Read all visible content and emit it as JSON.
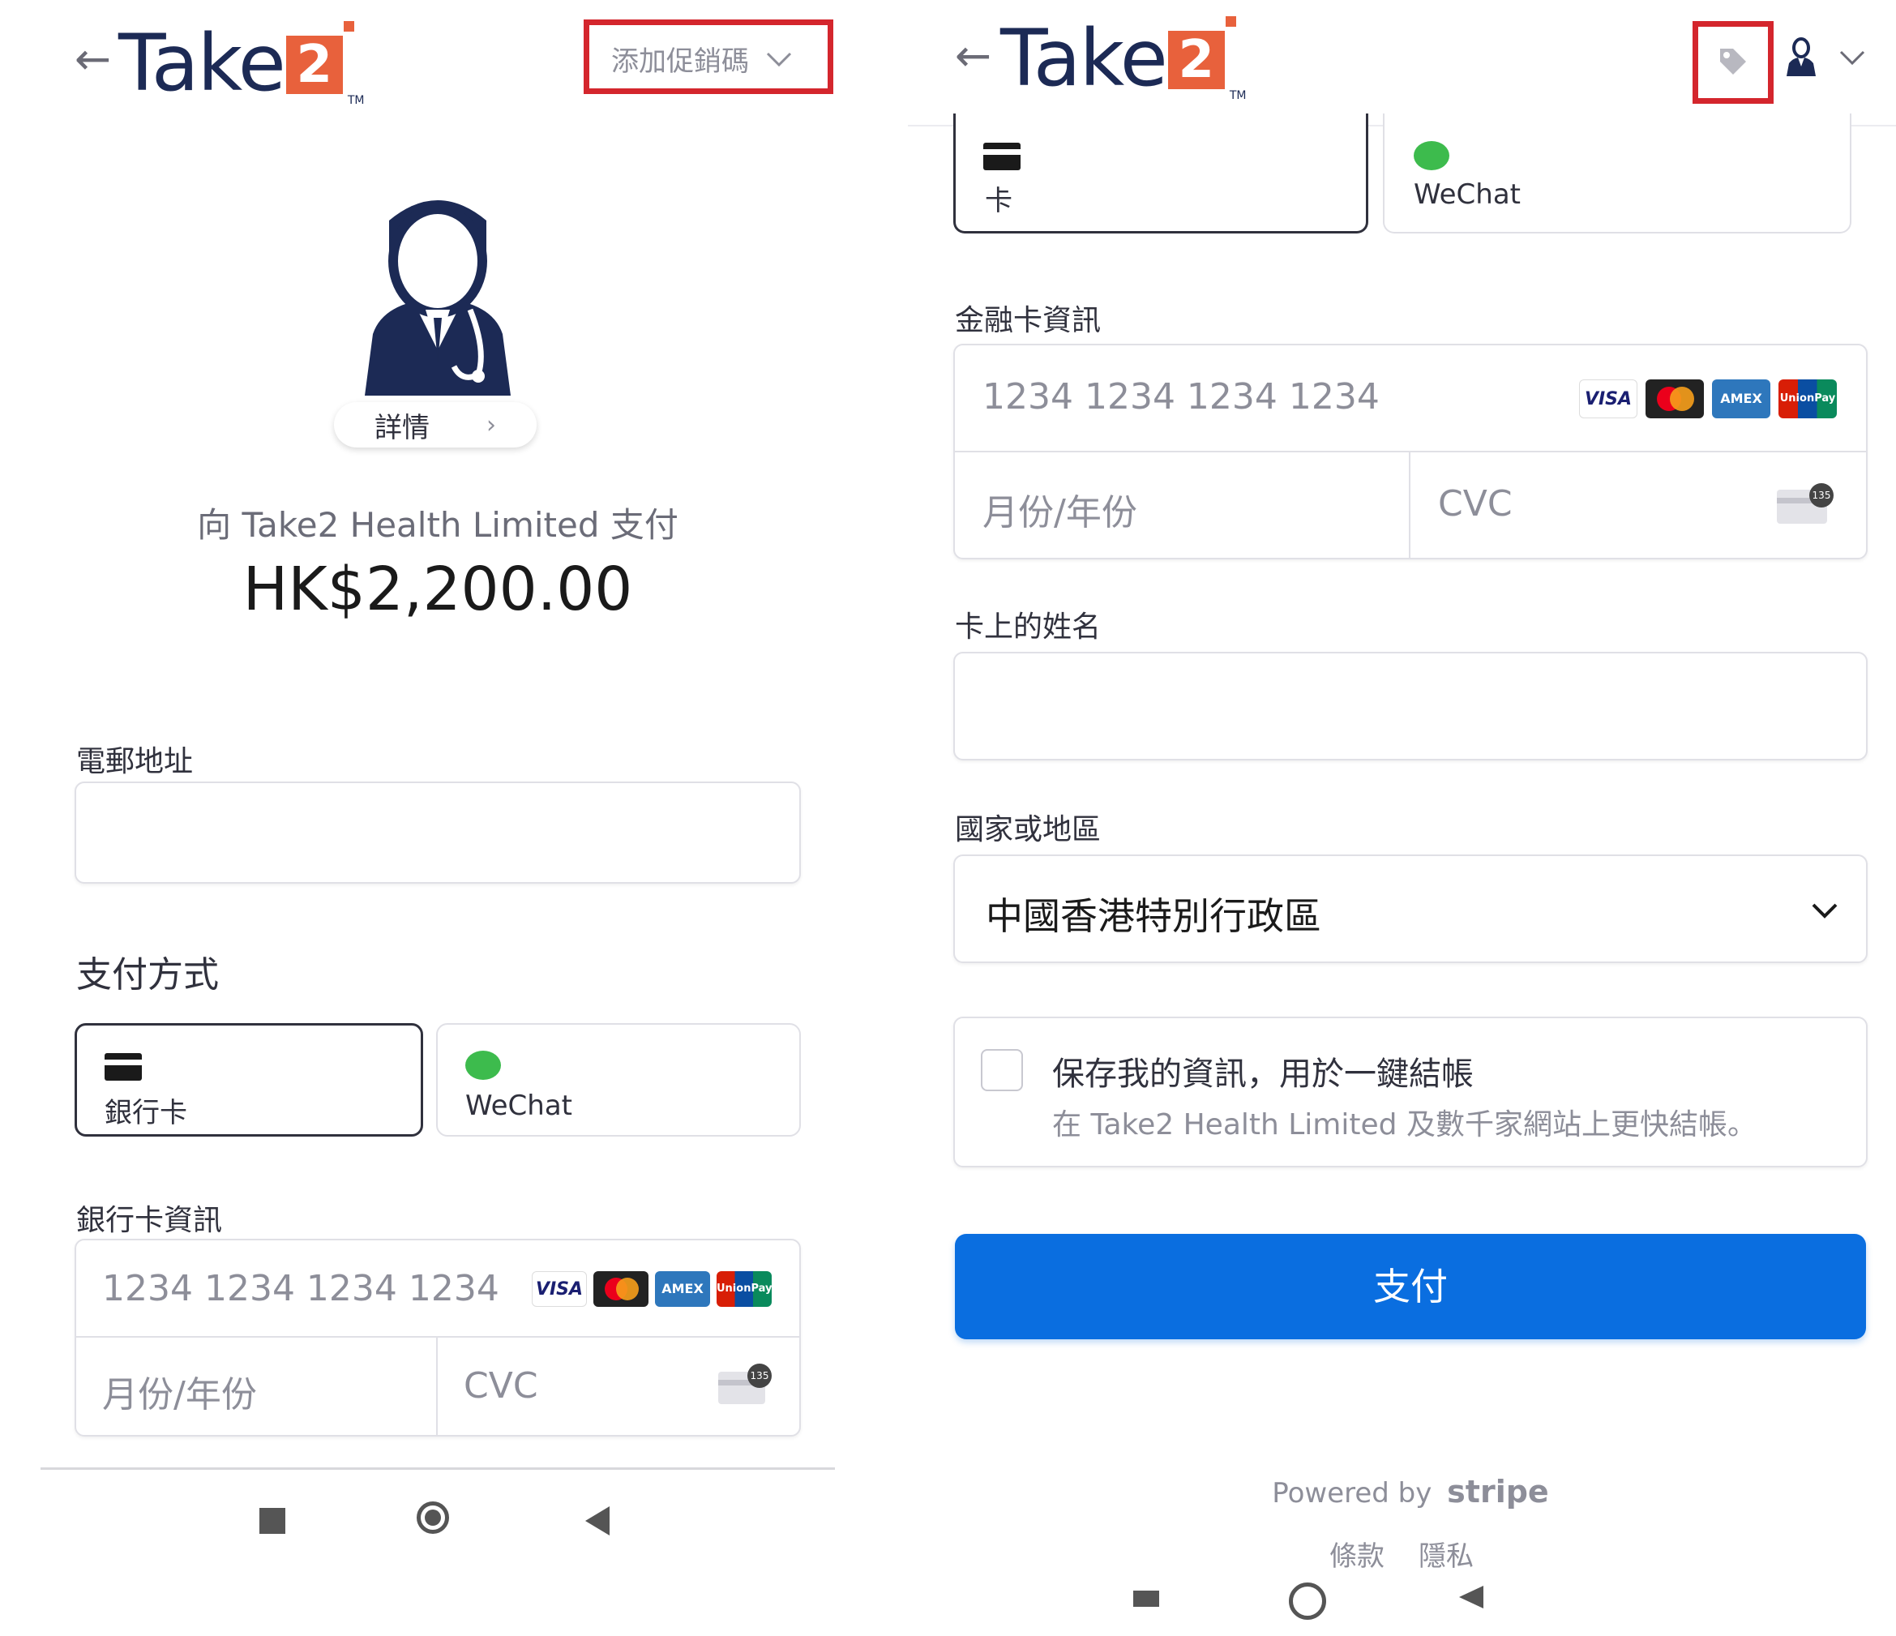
{
  "colors": {
    "brand_navy": "#1c2a55",
    "brand_orange": "#e8613c",
    "highlight_red": "#d4262d",
    "pay_button": "#0a6ee0",
    "wechat_green": "#3dbb4d"
  },
  "left": {
    "header": {
      "back_icon": "arrow-left-icon",
      "logo_word": "Take",
      "logo_digit": "2",
      "logo_tm": "TM",
      "promo_label": "添加促銷碼",
      "promo_icon": "chevron-down-icon"
    },
    "merchant": {
      "avatar_icon": "doctor-icon",
      "details_label": "詳情",
      "details_icon": "chevron-right-icon",
      "pay_to": "向 Take2 Health Limited 支付",
      "amount": "HK$2,200.00"
    },
    "email": {
      "label": "電郵地址",
      "value": ""
    },
    "payment_method": {
      "heading": "支付方式",
      "tabs": [
        {
          "label": "銀行卡",
          "icon": "card-icon"
        },
        {
          "label": "WeChat",
          "icon": "wechat-icon"
        }
      ]
    },
    "card": {
      "label": "銀行卡資訊",
      "number_placeholder": "1234 1234 1234 1234",
      "expiry_placeholder": "月份/年份",
      "cvc_placeholder": "CVC",
      "cvc_hint": "135",
      "brands": [
        "VISA",
        "Mastercard",
        "AMEX",
        "UnionPay"
      ]
    },
    "nav": [
      "stop-icon",
      "home-icon",
      "back-triangle-icon"
    ]
  },
  "right": {
    "header": {
      "back_icon": "arrow-left-icon",
      "logo_word": "Take",
      "logo_digit": "2",
      "logo_tm": "TM",
      "promo_icon": "tag-icon",
      "account_icon": "doctor-icon",
      "menu_icon": "chevron-down-icon"
    },
    "payment_method": {
      "tabs": [
        {
          "label": "卡",
          "icon": "card-icon"
        },
        {
          "label": "WeChat",
          "icon": "wechat-icon"
        }
      ]
    },
    "card": {
      "label": "金融卡資訊",
      "number_placeholder": "1234 1234 1234 1234",
      "expiry_placeholder": "月份/年份",
      "cvc_placeholder": "CVC",
      "cvc_hint": "135",
      "brands": [
        "VISA",
        "Mastercard",
        "AMEX",
        "UnionPay"
      ]
    },
    "name": {
      "label": "卡上的姓名",
      "value": ""
    },
    "country": {
      "label": "國家或地區",
      "value": "中國香港特別行政區"
    },
    "save": {
      "title": "保存我的資訊，用於一鍵結帳",
      "subtitle": "在 Take2 Health Limited 及數千家網站上更快結帳。",
      "checked": false
    },
    "pay_button": "支付",
    "footer": {
      "powered": "Powered by",
      "stripe": "stripe",
      "terms": "條款",
      "privacy": "隱私"
    },
    "nav": [
      "stop-icon",
      "home-icon",
      "back-triangle-icon"
    ]
  }
}
